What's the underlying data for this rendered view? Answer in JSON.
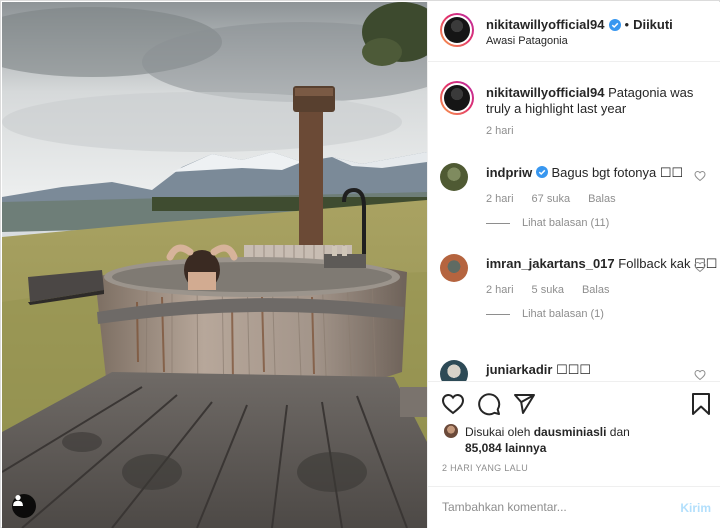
{
  "post": {
    "author": "nikitawillyofficial94",
    "follow_state": "Diikuti",
    "separator": "•",
    "location": "Awasi Patagonia"
  },
  "caption": {
    "username": "nikitawillyofficial94",
    "text": "Patagonia was truly a highlight last year",
    "time": "2 hari"
  },
  "comments": [
    {
      "username": "indpriw",
      "verified": true,
      "text": "Bagus bgt fotonya ☐☐",
      "time": "2 hari",
      "likes": "67 suka",
      "reply": "Balas",
      "view_replies": "Lihat balasan (11)"
    },
    {
      "username": "imran_jakartans_017",
      "verified": false,
      "text": "Follback kak ☐☐",
      "time": "2 hari",
      "likes": "5 suka",
      "reply": "Balas",
      "view_replies": "Lihat balasan (1)"
    },
    {
      "username": "juniarkadir",
      "verified": false,
      "text": "☐☐☐"
    }
  ],
  "likes": {
    "prefix": "Disukai oleh",
    "user": "dausminiasli",
    "joiner": "dan",
    "count": "85,084 lainnya"
  },
  "date": "2 HARI YANG LALU",
  "comment_box": {
    "placeholder": "Tambahkan komentar...",
    "post_label": "Kirim"
  },
  "icons": [
    "user-tag-icon",
    "verified-icon",
    "heart-icon",
    "comment-icon",
    "share-icon",
    "bookmark-icon"
  ],
  "colors": {
    "verified": "#3897f0",
    "post_button_disabled": "#b2dffc",
    "secondary_text": "#8e8e8e"
  }
}
